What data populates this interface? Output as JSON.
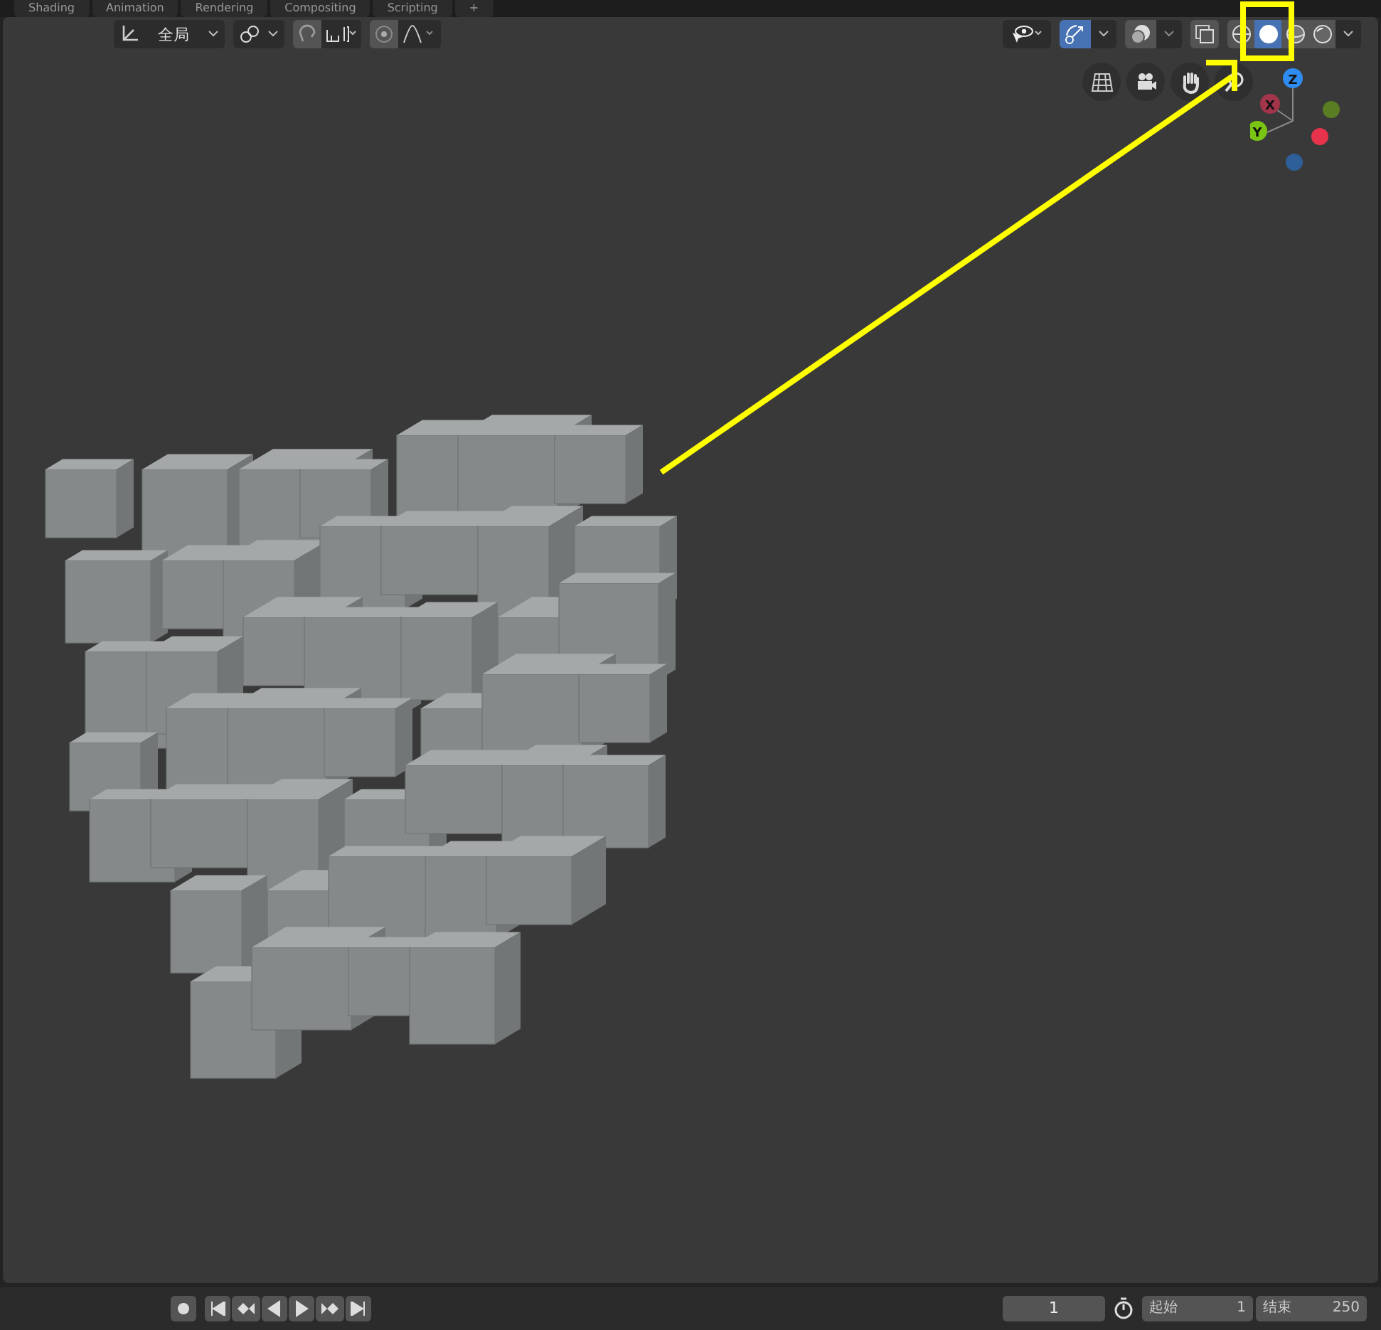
{
  "workspace_tabs": [
    {
      "label": "Shading",
      "selected": false
    },
    {
      "label": "Animation",
      "selected": false
    },
    {
      "label": "Rendering",
      "selected": false
    },
    {
      "label": "Compositing",
      "selected": false
    },
    {
      "label": "Scripting",
      "selected": false
    },
    {
      "label": "+",
      "selected": false
    }
  ],
  "header": {
    "transform_orientation": "全局"
  },
  "shading_modes": [
    {
      "kind": "wireframe",
      "selected": false
    },
    {
      "kind": "solid",
      "selected": true
    },
    {
      "kind": "material",
      "selected": false
    },
    {
      "kind": "rendered",
      "selected": false
    }
  ],
  "gizmo_axes": [
    {
      "label": "Z",
      "color": "#2f8cf0"
    },
    {
      "label": "X",
      "color": "#a3354a"
    },
    {
      "label": "Y",
      "color": "#7ac414"
    }
  ],
  "timeline": {
    "current_frame": "1",
    "start_label": "起始",
    "start": "1",
    "end_label": "结束",
    "end": "250"
  }
}
